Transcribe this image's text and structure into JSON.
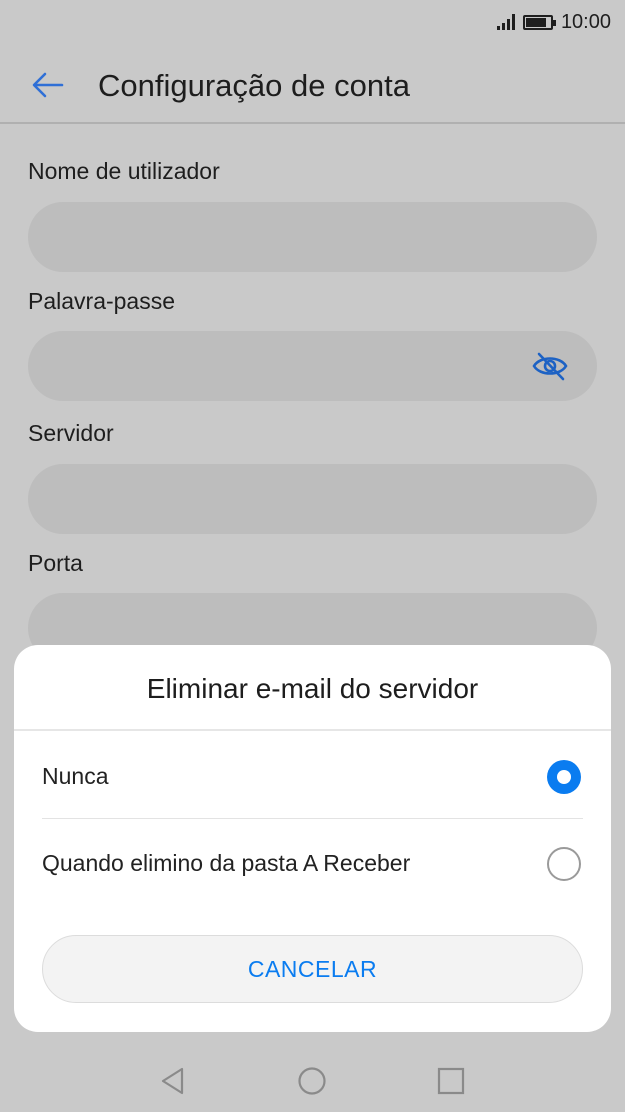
{
  "status_bar": {
    "time": "10:00",
    "battery_level": 0.85
  },
  "app_bar": {
    "title": "Configuração de conta"
  },
  "form": {
    "username_label": "Nome de utilizador",
    "password_label": "Palavra-passe",
    "server_label": "Servidor",
    "port_label": "Porta"
  },
  "dialog": {
    "title": "Eliminar e-mail do servidor",
    "options": [
      {
        "label": "Nunca",
        "selected": true
      },
      {
        "label": "Quando elimino da pasta A Receber",
        "selected": false
      }
    ],
    "cancel_label": "CANCELAR"
  },
  "colors": {
    "accent": "#0a7cf0",
    "scrim_bg": "#c9c9c9",
    "sheet_bg": "#ffffff"
  }
}
